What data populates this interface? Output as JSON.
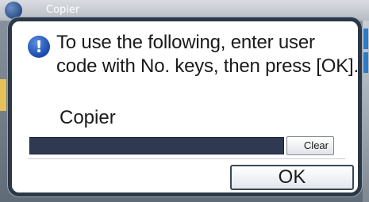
{
  "background": {
    "app_title": "Copier"
  },
  "dialog": {
    "icon": "exclamation-icon",
    "message_line1": "To use the following, enter user",
    "message_line2": "code with No. keys, then press [OK].",
    "field_label": "Copier",
    "input_value": "",
    "clear_label": "Clear",
    "ok_label": "OK"
  },
  "colors": {
    "dialog_border": "#2b3846",
    "input_background": "#2f3a52",
    "alert_icon": "#1d4fb0"
  }
}
